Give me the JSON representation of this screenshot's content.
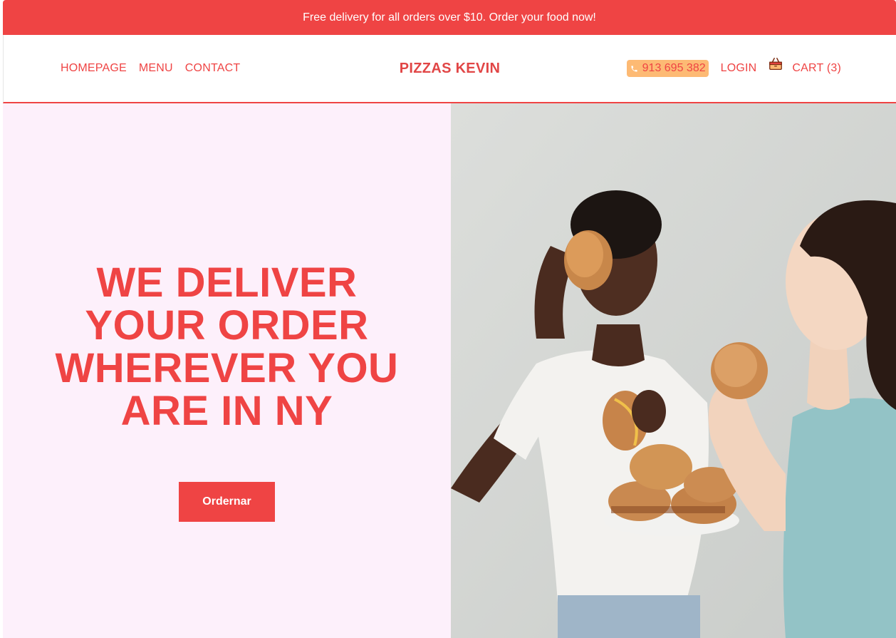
{
  "promo_bar": {
    "text": "Free delivery for all orders over $10. Order your food now!"
  },
  "nav": {
    "links": [
      "HOMEPAGE",
      "MENU",
      "CONTACT"
    ],
    "brand": "PIZZAS KEVIN",
    "phone": "913 695 382",
    "login": "LOGIN",
    "cart": "CART (3)"
  },
  "hero": {
    "title_lines": [
      "WE DELIVER",
      "YOUR ORDER",
      "WHEREVER YOU",
      "ARE IN NY"
    ],
    "button": "Ordernar",
    "image_icon": "people-eating-burgers-photo"
  },
  "colors": {
    "accent": "#ef4444",
    "hero_bg": "#fdf0fb",
    "phone_bg": "#fdba74"
  }
}
